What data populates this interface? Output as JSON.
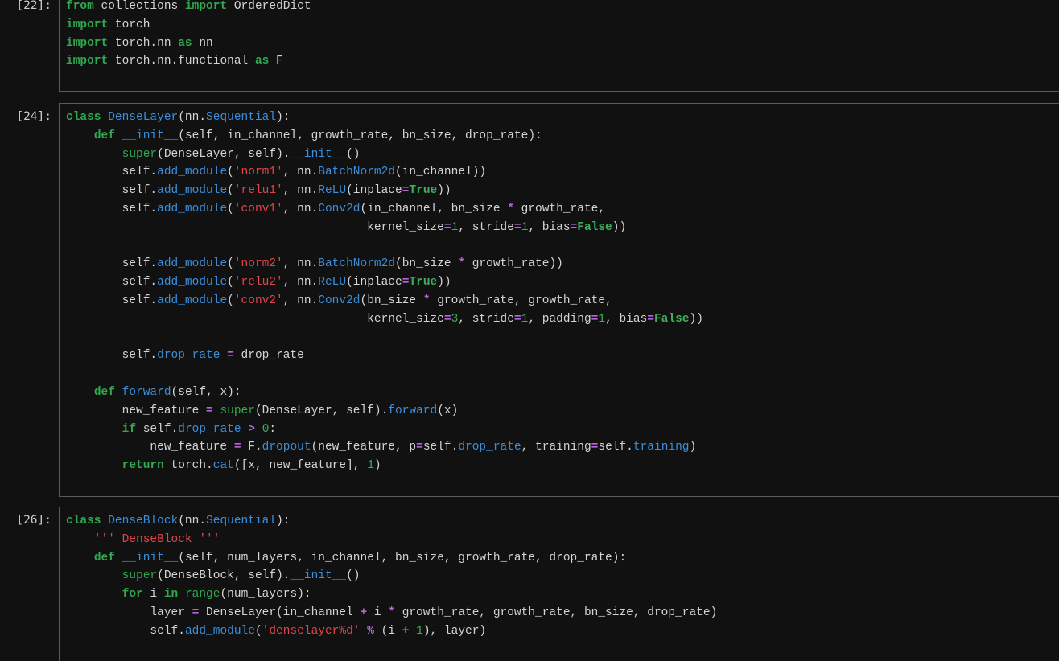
{
  "cells": [
    {
      "prompt": "[22]:",
      "lines": [
        [
          [
            "kw",
            "from"
          ],
          [
            "plain",
            " collections "
          ],
          [
            "kw",
            "import"
          ],
          [
            "plain",
            " OrderedDict"
          ]
        ],
        [
          [
            "kw",
            "import"
          ],
          [
            "plain",
            " torch"
          ]
        ],
        [
          [
            "kw",
            "import"
          ],
          [
            "plain",
            " torch.nn "
          ],
          [
            "kw",
            "as"
          ],
          [
            "plain",
            " nn"
          ]
        ],
        [
          [
            "kw",
            "import"
          ],
          [
            "plain",
            " torch.nn.functional "
          ],
          [
            "kw",
            "as"
          ],
          [
            "plain",
            " F"
          ]
        ],
        [
          [
            "plain",
            ""
          ]
        ]
      ]
    },
    {
      "prompt": "[24]:",
      "lines": [
        [
          [
            "kw",
            "class"
          ],
          [
            "plain",
            " "
          ],
          [
            "cls",
            "DenseLayer"
          ],
          [
            "plain",
            "(nn."
          ],
          [
            "attr",
            "Sequential"
          ],
          [
            "plain",
            "):"
          ]
        ],
        [
          [
            "plain",
            "    "
          ],
          [
            "kw",
            "def"
          ],
          [
            "plain",
            " "
          ],
          [
            "fn",
            "__init__"
          ],
          [
            "plain",
            "(self, in_channel, growth_rate, bn_size, drop_rate):"
          ]
        ],
        [
          [
            "plain",
            "        "
          ],
          [
            "bi",
            "super"
          ],
          [
            "plain",
            "(DenseLayer, self)."
          ],
          [
            "fn",
            "__init__"
          ],
          [
            "plain",
            "()"
          ]
        ],
        [
          [
            "plain",
            "        self."
          ],
          [
            "attr",
            "add_module"
          ],
          [
            "plain",
            "("
          ],
          [
            "str",
            "'norm1'"
          ],
          [
            "plain",
            ", nn."
          ],
          [
            "attr",
            "BatchNorm2d"
          ],
          [
            "plain",
            "(in_channel))"
          ]
        ],
        [
          [
            "plain",
            "        self."
          ],
          [
            "attr",
            "add_module"
          ],
          [
            "plain",
            "("
          ],
          [
            "str",
            "'relu1'"
          ],
          [
            "plain",
            ", nn."
          ],
          [
            "attr",
            "ReLU"
          ],
          [
            "plain",
            "(inplace"
          ],
          [
            "op",
            "="
          ],
          [
            "const",
            "True"
          ],
          [
            "plain",
            "))"
          ]
        ],
        [
          [
            "plain",
            "        self."
          ],
          [
            "attr",
            "add_module"
          ],
          [
            "plain",
            "("
          ],
          [
            "str",
            "'conv1'"
          ],
          [
            "plain",
            ", nn."
          ],
          [
            "attr",
            "Conv2d"
          ],
          [
            "plain",
            "(in_channel, bn_size "
          ],
          [
            "op",
            "*"
          ],
          [
            "plain",
            " growth_rate,"
          ]
        ],
        [
          [
            "plain",
            "                                           kernel_size"
          ],
          [
            "op",
            "="
          ],
          [
            "num",
            "1"
          ],
          [
            "plain",
            ", stride"
          ],
          [
            "op",
            "="
          ],
          [
            "num",
            "1"
          ],
          [
            "plain",
            ", bias"
          ],
          [
            "op",
            "="
          ],
          [
            "const",
            "False"
          ],
          [
            "plain",
            "))"
          ]
        ],
        [
          [
            "plain",
            ""
          ]
        ],
        [
          [
            "plain",
            "        self."
          ],
          [
            "attr",
            "add_module"
          ],
          [
            "plain",
            "("
          ],
          [
            "str",
            "'norm2'"
          ],
          [
            "plain",
            ", nn."
          ],
          [
            "attr",
            "BatchNorm2d"
          ],
          [
            "plain",
            "(bn_size "
          ],
          [
            "op",
            "*"
          ],
          [
            "plain",
            " growth_rate))"
          ]
        ],
        [
          [
            "plain",
            "        self."
          ],
          [
            "attr",
            "add_module"
          ],
          [
            "plain",
            "("
          ],
          [
            "str",
            "'relu2'"
          ],
          [
            "plain",
            ", nn."
          ],
          [
            "attr",
            "ReLU"
          ],
          [
            "plain",
            "(inplace"
          ],
          [
            "op",
            "="
          ],
          [
            "const",
            "True"
          ],
          [
            "plain",
            "))"
          ]
        ],
        [
          [
            "plain",
            "        self."
          ],
          [
            "attr",
            "add_module"
          ],
          [
            "plain",
            "("
          ],
          [
            "str",
            "'conv2'"
          ],
          [
            "plain",
            ", nn."
          ],
          [
            "attr",
            "Conv2d"
          ],
          [
            "plain",
            "(bn_size "
          ],
          [
            "op",
            "*"
          ],
          [
            "plain",
            " growth_rate, growth_rate,"
          ]
        ],
        [
          [
            "plain",
            "                                           kernel_size"
          ],
          [
            "op",
            "="
          ],
          [
            "num",
            "3"
          ],
          [
            "plain",
            ", stride"
          ],
          [
            "op",
            "="
          ],
          [
            "num",
            "1"
          ],
          [
            "plain",
            ", padding"
          ],
          [
            "op",
            "="
          ],
          [
            "num",
            "1"
          ],
          [
            "plain",
            ", bias"
          ],
          [
            "op",
            "="
          ],
          [
            "const",
            "False"
          ],
          [
            "plain",
            "))"
          ]
        ],
        [
          [
            "plain",
            ""
          ]
        ],
        [
          [
            "plain",
            "        self."
          ],
          [
            "attr",
            "drop_rate"
          ],
          [
            "plain",
            " "
          ],
          [
            "op",
            "="
          ],
          [
            "plain",
            " drop_rate"
          ]
        ],
        [
          [
            "plain",
            ""
          ]
        ],
        [
          [
            "plain",
            "    "
          ],
          [
            "kw",
            "def"
          ],
          [
            "plain",
            " "
          ],
          [
            "fn",
            "forward"
          ],
          [
            "plain",
            "(self, x):"
          ]
        ],
        [
          [
            "plain",
            "        new_feature "
          ],
          [
            "op",
            "="
          ],
          [
            "plain",
            " "
          ],
          [
            "bi",
            "super"
          ],
          [
            "plain",
            "(DenseLayer, self)."
          ],
          [
            "attr",
            "forward"
          ],
          [
            "plain",
            "(x)"
          ]
        ],
        [
          [
            "plain",
            "        "
          ],
          [
            "kw",
            "if"
          ],
          [
            "plain",
            " self."
          ],
          [
            "attr",
            "drop_rate"
          ],
          [
            "plain",
            " "
          ],
          [
            "op",
            ">"
          ],
          [
            "plain",
            " "
          ],
          [
            "num",
            "0"
          ],
          [
            "plain",
            ":"
          ]
        ],
        [
          [
            "plain",
            "            new_feature "
          ],
          [
            "op",
            "="
          ],
          [
            "plain",
            " F."
          ],
          [
            "attr",
            "dropout"
          ],
          [
            "plain",
            "(new_feature, p"
          ],
          [
            "op",
            "="
          ],
          [
            "plain",
            "self."
          ],
          [
            "attr",
            "drop_rate"
          ],
          [
            "plain",
            ", training"
          ],
          [
            "op",
            "="
          ],
          [
            "plain",
            "self."
          ],
          [
            "attr",
            "training"
          ],
          [
            "plain",
            ")"
          ]
        ],
        [
          [
            "plain",
            "        "
          ],
          [
            "kw",
            "return"
          ],
          [
            "plain",
            " torch."
          ],
          [
            "attr",
            "cat"
          ],
          [
            "plain",
            "([x, new_feature], "
          ],
          [
            "num",
            "1"
          ],
          [
            "plain",
            ")"
          ]
        ],
        [
          [
            "plain",
            ""
          ]
        ]
      ]
    },
    {
      "prompt": "[26]:",
      "lines": [
        [
          [
            "kw",
            "class"
          ],
          [
            "plain",
            " "
          ],
          [
            "cls",
            "DenseBlock"
          ],
          [
            "plain",
            "(nn."
          ],
          [
            "attr",
            "Sequential"
          ],
          [
            "plain",
            "):"
          ]
        ],
        [
          [
            "plain",
            "    "
          ],
          [
            "str",
            "''' DenseBlock '''"
          ]
        ],
        [
          [
            "plain",
            "    "
          ],
          [
            "kw",
            "def"
          ],
          [
            "plain",
            " "
          ],
          [
            "fn",
            "__init__"
          ],
          [
            "plain",
            "(self, num_layers, in_channel, bn_size, growth_rate, drop_rate):"
          ]
        ],
        [
          [
            "plain",
            "        "
          ],
          [
            "bi",
            "super"
          ],
          [
            "plain",
            "(DenseBlock, self)."
          ],
          [
            "fn",
            "__init__"
          ],
          [
            "plain",
            "()"
          ]
        ],
        [
          [
            "plain",
            "        "
          ],
          [
            "kw",
            "for"
          ],
          [
            "plain",
            " i "
          ],
          [
            "kw",
            "in"
          ],
          [
            "plain",
            " "
          ],
          [
            "bi",
            "range"
          ],
          [
            "plain",
            "(num_layers):"
          ]
        ],
        [
          [
            "plain",
            "            layer "
          ],
          [
            "op",
            "="
          ],
          [
            "plain",
            " DenseLayer(in_channel "
          ],
          [
            "op",
            "+"
          ],
          [
            "plain",
            " i "
          ],
          [
            "op",
            "*"
          ],
          [
            "plain",
            " growth_rate, growth_rate, bn_size, drop_rate)"
          ]
        ],
        [
          [
            "plain",
            "            self."
          ],
          [
            "attr",
            "add_module"
          ],
          [
            "plain",
            "("
          ],
          [
            "str",
            "'denselayer%d'"
          ],
          [
            "plain",
            " "
          ],
          [
            "op",
            "%"
          ],
          [
            "plain",
            " (i "
          ],
          [
            "op",
            "+"
          ],
          [
            "plain",
            " "
          ],
          [
            "num",
            "1"
          ],
          [
            "plain",
            "), layer)"
          ]
        ],
        [
          [
            "plain",
            ""
          ]
        ]
      ]
    }
  ]
}
